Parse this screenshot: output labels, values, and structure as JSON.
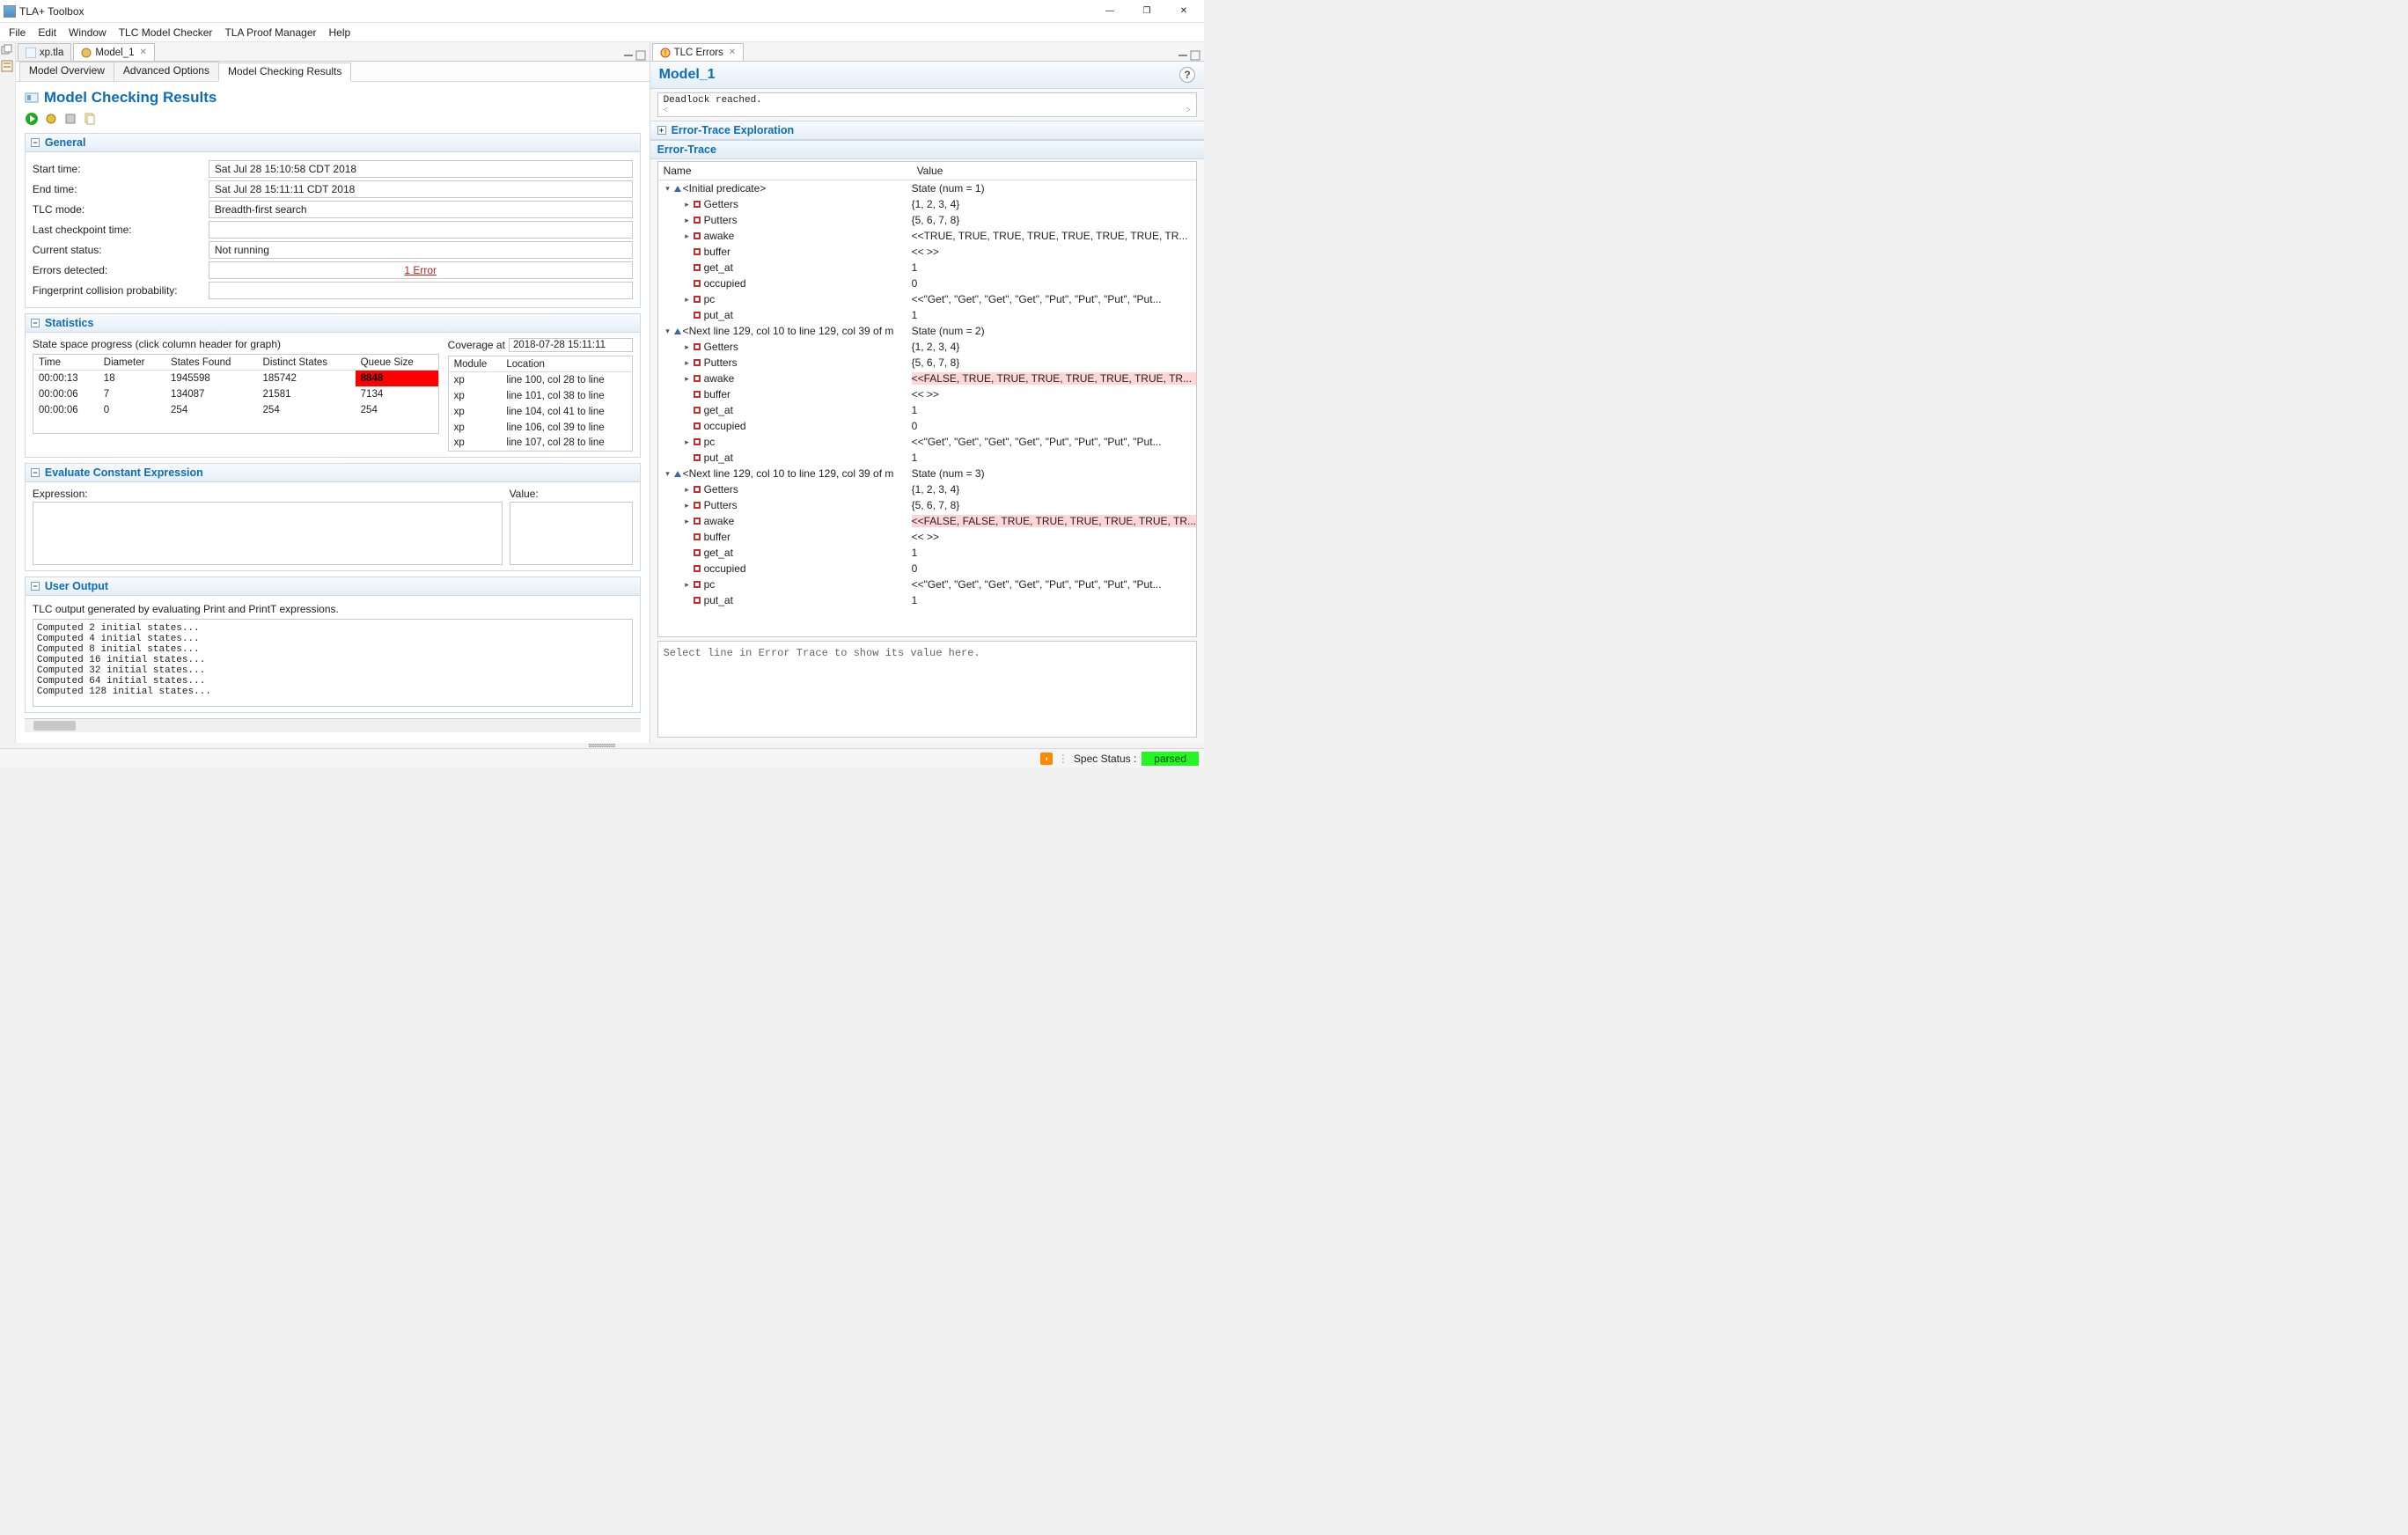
{
  "titlebar": {
    "app_title": "TLA+ Toolbox"
  },
  "menubar": [
    "File",
    "Edit",
    "Window",
    "TLC Model Checker",
    "TLA Proof Manager",
    "Help"
  ],
  "left_tabs": [
    "xp.tla",
    "Model_1"
  ],
  "right_tabs": [
    "TLC Errors"
  ],
  "subtabs": [
    "Model Overview",
    "Advanced Options",
    "Model Checking Results"
  ],
  "mcr": {
    "title": "Model Checking Results",
    "general": {
      "title": "General",
      "rows": [
        {
          "label": "Start time:",
          "value": "Sat Jul 28 15:10:58 CDT 2018"
        },
        {
          "label": "End time:",
          "value": "Sat Jul 28 15:11:11 CDT 2018"
        },
        {
          "label": "TLC mode:",
          "value": "Breadth-first search"
        },
        {
          "label": "Last checkpoint time:",
          "value": ""
        },
        {
          "label": "Current status:",
          "value": "Not running"
        },
        {
          "label": "Errors detected:",
          "value": "1 Error",
          "link": true
        },
        {
          "label": "Fingerprint collision probability:",
          "value": ""
        }
      ]
    },
    "statistics": {
      "title": "Statistics",
      "hint": "State space progress (click column header for graph)",
      "coverage_label": "Coverage at",
      "coverage_val": "2018-07-28 15:11:11",
      "cols": [
        "Time",
        "Diameter",
        "States Found",
        "Distinct States",
        "Queue Size"
      ],
      "rows": [
        [
          "00:00:13",
          "18",
          "1945598",
          "185742",
          "8848"
        ],
        [
          "00:00:06",
          "7",
          "134087",
          "21581",
          "7134"
        ],
        [
          "00:00:06",
          "0",
          "254",
          "254",
          "254"
        ]
      ],
      "hot_cell": {
        "r": 0,
        "c": 4
      },
      "cov_cols": [
        "Module",
        "Location"
      ],
      "cov_rows": [
        [
          "xp",
          "line 100, col 28 to line"
        ],
        [
          "xp",
          "line 101, col 38 to line"
        ],
        [
          "xp",
          "line 104, col 41 to line"
        ],
        [
          "xp",
          "line 106, col 39 to line"
        ],
        [
          "xp",
          "line 107, col 28 to line"
        ]
      ]
    },
    "eval": {
      "title": "Evaluate Constant Expression",
      "expr_label": "Expression:",
      "value_label": "Value:"
    },
    "userout": {
      "title": "User Output",
      "desc": "TLC output generated by evaluating Print and PrintT expressions.",
      "text": "Computed 2 initial states...\nComputed 4 initial states...\nComputed 8 initial states...\nComputed 16 initial states...\nComputed 32 initial states...\nComputed 64 initial states...\nComputed 128 initial states..."
    }
  },
  "errors": {
    "model_name": "Model_1",
    "deadlock": "Deadlock reached.",
    "explore_title": "Error-Trace Exploration",
    "trace_title": "Error-Trace",
    "cols": [
      "Name",
      "Value"
    ],
    "preview_placeholder": "Select line in Error Trace to show its value here.",
    "states": [
      {
        "name": "<Initial predicate>",
        "value": "State (num = 1)",
        "vars": [
          {
            "twist": ">",
            "name": "Getters",
            "val": "{1, 2, 3, 4}"
          },
          {
            "twist": ">",
            "name": "Putters",
            "val": "{5, 6, 7, 8}"
          },
          {
            "twist": ">",
            "name": "awake",
            "val": "<<TRUE, TRUE, TRUE, TRUE, TRUE, TRUE, TRUE, TR..."
          },
          {
            "twist": "",
            "name": "buffer",
            "val": "<< >>"
          },
          {
            "twist": "",
            "name": "get_at",
            "val": "1"
          },
          {
            "twist": "",
            "name": "occupied",
            "val": "0"
          },
          {
            "twist": ">",
            "name": "pc",
            "val": "<<\"Get\", \"Get\", \"Get\", \"Get\", \"Put\", \"Put\", \"Put\", \"Put..."
          },
          {
            "twist": "",
            "name": "put_at",
            "val": "1"
          }
        ]
      },
      {
        "name": "<Next line 129, col 10 to line 129, col 39 of m",
        "value": "State (num = 2)",
        "vars": [
          {
            "twist": ">",
            "name": "Getters",
            "val": "{1, 2, 3, 4}"
          },
          {
            "twist": ">",
            "name": "Putters",
            "val": "{5, 6, 7, 8}"
          },
          {
            "twist": ">",
            "name": "awake",
            "val": "<<FALSE, TRUE, TRUE, TRUE, TRUE, TRUE, TRUE, TR...",
            "changed": true
          },
          {
            "twist": "",
            "name": "buffer",
            "val": "<< >>"
          },
          {
            "twist": "",
            "name": "get_at",
            "val": "1"
          },
          {
            "twist": "",
            "name": "occupied",
            "val": "0"
          },
          {
            "twist": ">",
            "name": "pc",
            "val": "<<\"Get\", \"Get\", \"Get\", \"Get\", \"Put\", \"Put\", \"Put\", \"Put..."
          },
          {
            "twist": "",
            "name": "put_at",
            "val": "1"
          }
        ]
      },
      {
        "name": "<Next line 129, col 10 to line 129, col 39 of m",
        "value": "State (num = 3)",
        "vars": [
          {
            "twist": ">",
            "name": "Getters",
            "val": "{1, 2, 3, 4}"
          },
          {
            "twist": ">",
            "name": "Putters",
            "val": "{5, 6, 7, 8}"
          },
          {
            "twist": ">",
            "name": "awake",
            "val": "<<FALSE, FALSE, TRUE, TRUE, TRUE, TRUE, TRUE, TR...",
            "changed": true
          },
          {
            "twist": "",
            "name": "buffer",
            "val": "<< >>"
          },
          {
            "twist": "",
            "name": "get_at",
            "val": "1"
          },
          {
            "twist": "",
            "name": "occupied",
            "val": "0"
          },
          {
            "twist": ">",
            "name": "pc",
            "val": "<<\"Get\", \"Get\", \"Get\", \"Get\", \"Put\", \"Put\", \"Put\", \"Put..."
          },
          {
            "twist": "",
            "name": "put_at",
            "val": "1"
          }
        ]
      }
    ]
  },
  "statusbar": {
    "spec_label": "Spec Status :",
    "spec_value": "parsed"
  }
}
